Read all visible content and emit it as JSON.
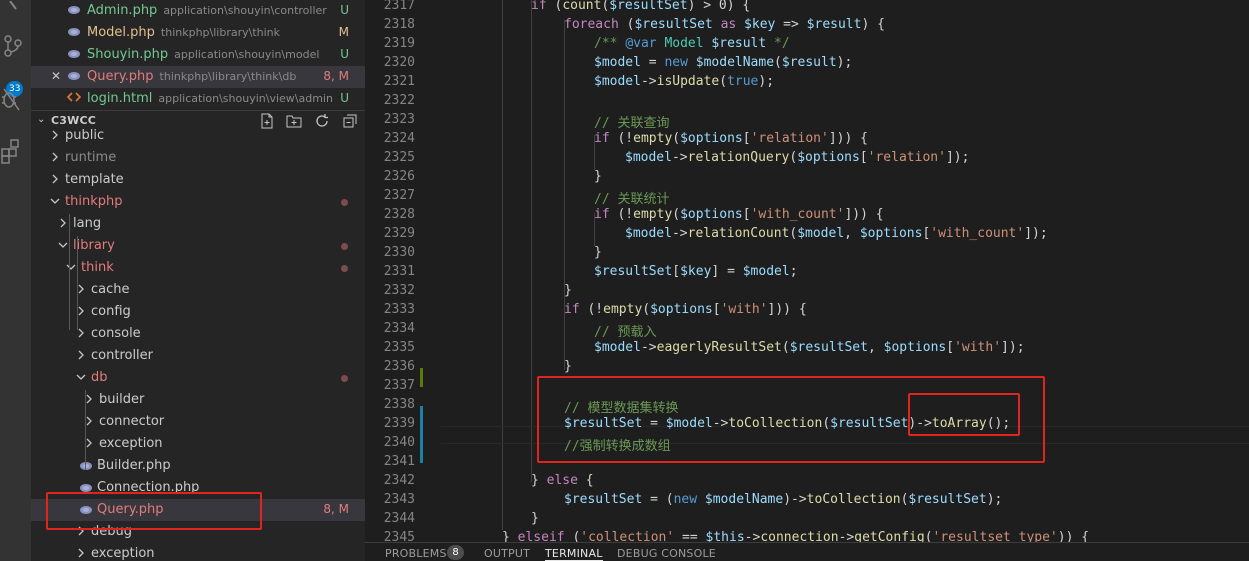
{
  "activity_bar": {
    "scm_badge": "33"
  },
  "open_editors": [
    {
      "name": "Admin.php",
      "path": "application\\shouyin\\controller",
      "status": "U",
      "type": "php"
    },
    {
      "name": "Model.php",
      "path": "thinkphp\\library\\think",
      "status": "M",
      "type": "php"
    },
    {
      "name": "Shouyin.php",
      "path": "application\\shouyin\\model",
      "status": "U",
      "type": "php"
    },
    {
      "name": "Query.php",
      "path": "thinkphp\\library\\think\\db",
      "status": "8, M",
      "type": "php"
    },
    {
      "name": "login.html",
      "path": "application\\shouyin\\view\\admin",
      "status": "U",
      "type": "html"
    }
  ],
  "explorer": {
    "section_title": "C3WCC",
    "tree": [
      {
        "label": "public",
        "status": ""
      },
      {
        "label": "runtime",
        "status": ""
      },
      {
        "label": "template",
        "status": ""
      },
      {
        "label": "thinkphp",
        "status": ""
      },
      {
        "label": "lang",
        "status": ""
      },
      {
        "label": "library",
        "status": ""
      },
      {
        "label": "think",
        "status": ""
      },
      {
        "label": "cache",
        "status": ""
      },
      {
        "label": "config",
        "status": ""
      },
      {
        "label": "console",
        "status": ""
      },
      {
        "label": "controller",
        "status": ""
      },
      {
        "label": "db",
        "status": ""
      },
      {
        "label": "builder",
        "status": ""
      },
      {
        "label": "connector",
        "status": ""
      },
      {
        "label": "exception",
        "status": ""
      },
      {
        "label": "Builder.php",
        "status": ""
      },
      {
        "label": "Connection.php",
        "status": ""
      },
      {
        "label": "Query.php",
        "status": "8, M"
      },
      {
        "label": "debug",
        "status": ""
      },
      {
        "label": "exception",
        "status": ""
      }
    ]
  },
  "editor": {
    "lines": [
      {
        "n": "2317",
        "t": "if (count($resultSet) > 0) {"
      },
      {
        "n": "2318",
        "t": "foreach ($resultSet as $key => $result) {"
      },
      {
        "n": "2319",
        "t": "/** @var Model $result */"
      },
      {
        "n": "2320",
        "t": "$model = new $modelName($result);"
      },
      {
        "n": "2321",
        "t": "$model->isUpdate(true);"
      },
      {
        "n": "2322",
        "t": ""
      },
      {
        "n": "2323",
        "t": "// 关联查询"
      },
      {
        "n": "2324",
        "t": "if (!empty($options['relation'])) {"
      },
      {
        "n": "2325",
        "t": "$model->relationQuery($options['relation']);"
      },
      {
        "n": "2326",
        "t": "}"
      },
      {
        "n": "2327",
        "t": "// 关联统计"
      },
      {
        "n": "2328",
        "t": "if (!empty($options['with_count'])) {"
      },
      {
        "n": "2329",
        "t": "$model->relationCount($model, $options['with_count']);"
      },
      {
        "n": "2330",
        "t": "}"
      },
      {
        "n": "2331",
        "t": "$resultSet[$key] = $model;"
      },
      {
        "n": "2332",
        "t": "}"
      },
      {
        "n": "2333",
        "t": "if (!empty($options['with'])) {"
      },
      {
        "n": "2334",
        "t": "// 预载入"
      },
      {
        "n": "2335",
        "t": "$model->eagerlyResultSet($resultSet, $options['with']);"
      },
      {
        "n": "2336",
        "t": "}"
      },
      {
        "n": "2337",
        "t": ""
      },
      {
        "n": "2338",
        "t": "// 模型数据集转换"
      },
      {
        "n": "2339",
        "t": "$resultSet = $model->toCollection($resultSet)->toArray();"
      },
      {
        "n": "2340",
        "t": "//强制转换成数组"
      },
      {
        "n": "2341",
        "t": ""
      },
      {
        "n": "2342",
        "t": "} else {"
      },
      {
        "n": "2343",
        "t": "$resultSet = (new $modelName)->toCollection($resultSet);"
      },
      {
        "n": "2344",
        "t": "}"
      },
      {
        "n": "2345",
        "t": "} elseif ('collection' == $this->connection->getConfig('resultset_type')) {"
      }
    ]
  },
  "panel": {
    "tabs": [
      "PROBLEMS",
      "OUTPUT",
      "TERMINAL",
      "DEBUG CONSOLE"
    ],
    "problems_count": "8",
    "active_tab": "TERMINAL"
  },
  "colors": {
    "annotation_box": "#e0251f",
    "modified_red": "#e27c7c",
    "untracked_green": "#73c991",
    "modified_yellow": "#e2c08d"
  }
}
